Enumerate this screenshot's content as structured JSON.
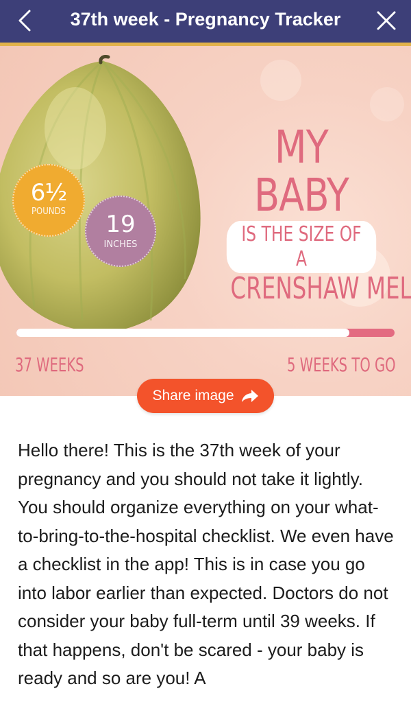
{
  "header": {
    "title": "37th week - Pregnancy Tracker",
    "back_icon": "chevron-left-icon",
    "close_icon": "close-icon",
    "bg_color": "#3d3f78",
    "stripe_color": "#e2b24a"
  },
  "hero": {
    "headline_line1": "MY BABY",
    "headline_line2": "IS THE SIZE OF A",
    "headline_line3": "CRENSHAW MELON",
    "weight_value": "6½",
    "weight_unit": "POUNDS",
    "length_value": "19",
    "length_unit": "INCHES",
    "progress_fraction": 0.88,
    "weeks_elapsed_label": "37 WEEKS",
    "weeks_remaining_label": "5 WEEKS TO GO",
    "accent_color": "#df6a7e"
  },
  "share": {
    "label": "Share image",
    "icon": "share-arrow-icon",
    "color": "#f3532b"
  },
  "body": {
    "text": "Hello there! This is the 37th week of your pregnancy and you should not take it lightly. You should organize everything on your what-to-bring-to-the-hospital checklist. We even have a checklist in the app! This is in case you go into labor earlier than expected. Doctors do not consider your baby full-term until 39 weeks. If that happens, don't be scared - your baby is ready and so are you! A"
  }
}
